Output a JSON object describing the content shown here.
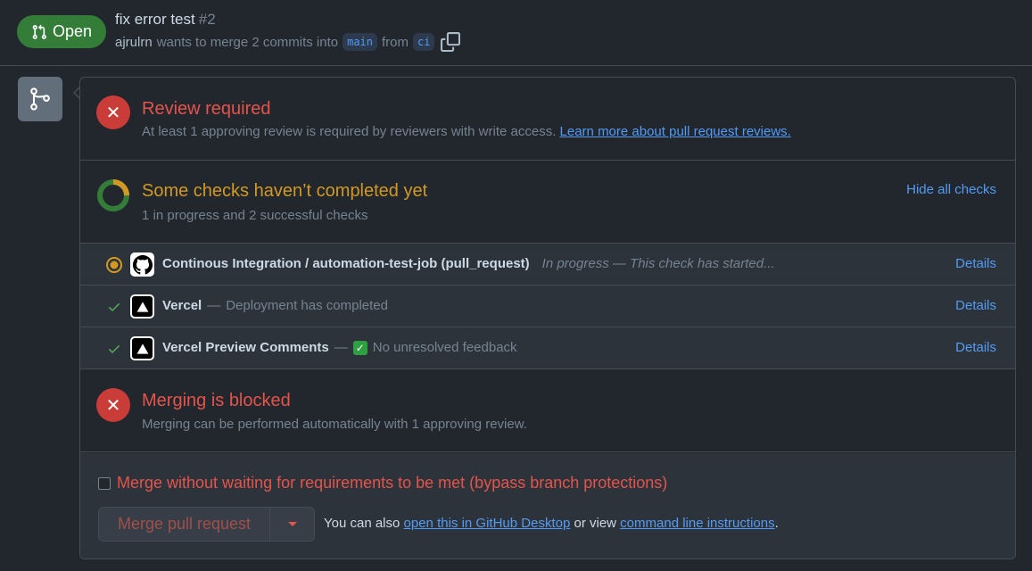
{
  "header": {
    "state": "Open",
    "title": "fix error test",
    "number": "#2",
    "author": "ajrulrn",
    "meta_text": "wants to merge 2 commits into",
    "base_branch": "main",
    "from_text": "from",
    "head_branch": "ci"
  },
  "review": {
    "title": "Review required",
    "subtitle": "At least 1 approving review is required by reviewers with write access.",
    "link": "Learn more about pull request reviews."
  },
  "checks": {
    "title": "Some checks haven’t completed yet",
    "subtitle": "1 in progress and 2 successful checks",
    "toggle": "Hide all checks",
    "items": [
      {
        "status": "in-progress",
        "name": "Continous Integration / automation-test-job (pull_request)",
        "description": "In progress — This check has started...",
        "details": "Details"
      },
      {
        "status": "success",
        "name": "Vercel",
        "separator": "—",
        "description": "Deployment has completed",
        "details": "Details"
      },
      {
        "status": "success",
        "name": "Vercel Preview Comments",
        "separator": "—",
        "description": "No unresolved feedback",
        "details": "Details"
      }
    ]
  },
  "blocked": {
    "title": "Merging is blocked",
    "subtitle": "Merging can be performed automatically with 1 approving review."
  },
  "merge": {
    "bypass_label": "Merge without waiting for requirements to be met (bypass branch protections)",
    "button_label": "Merge pull request",
    "also_prefix": "You can also",
    "desktop_link": "open this in GitHub Desktop",
    "or_view": "or view",
    "cli_link": "command line instructions",
    "suffix": "."
  },
  "colors": {
    "open_green": "#347d39",
    "danger_red": "#e5534b",
    "pending_orange": "#d29922",
    "link_blue": "#539bf5"
  }
}
